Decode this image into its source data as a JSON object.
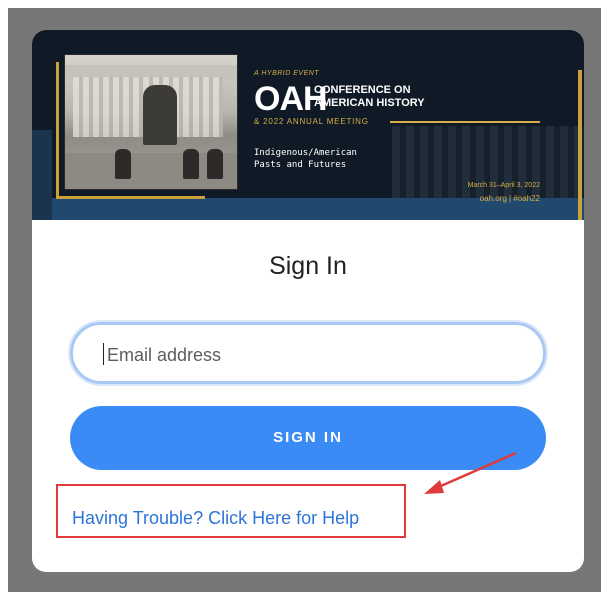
{
  "banner": {
    "tagline": "A HYBRID EVENT",
    "logo": "OAH",
    "conference_line1": "CONFERENCE ON",
    "conference_line2": "AMERICAN HISTORY",
    "meeting": "& 2022 ANNUAL MEETING",
    "theme_line1": "Indigenous/American",
    "theme_line2": "Pasts and Futures",
    "dates": "March 31–April 3, 2022",
    "site": "oah.org | #oah22"
  },
  "form": {
    "title": "Sign In",
    "email_placeholder": "Email address",
    "signin_label": "SIGN IN"
  },
  "help": {
    "link_text": "Having Trouble? Click Here for Help"
  },
  "colors": {
    "primary_button": "#3a8bf5",
    "link": "#2d74d8",
    "annotation": "#e03a3a",
    "banner_bg": "#0f1a26",
    "banner_gold": "#c9a23e"
  }
}
